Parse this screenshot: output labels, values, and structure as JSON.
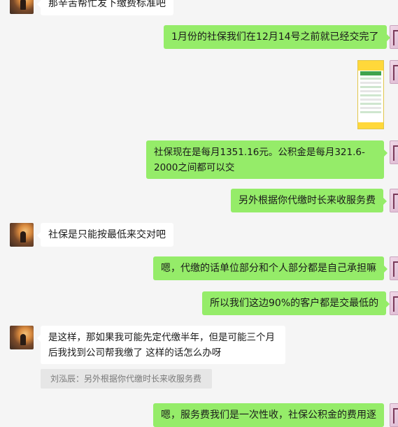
{
  "messages": [
    {
      "text": "那辛苦帮忙发下缴费标准吧"
    },
    {
      "text": "1月份的社保我们在12月14号之前就已经交完了"
    },
    {
      "text": "社保现在是每月1351.16元。公积金是每月321.6-2000之间都可以交"
    },
    {
      "text": "另外根据你代缴时长来收服务费"
    },
    {
      "text": "社保是只能按最低来交对吧"
    },
    {
      "text": "嗯，代缴的话单位部分和个人部分都是自己承担嘛"
    },
    {
      "text": "所以我们这边90%的客户都是交最低的"
    },
    {
      "text": "是这样，那如果我可能先定代缴半年，但是可能三个月后我找到公司帮我缴了  这样的话怎么办呀"
    },
    {
      "quote": "刘泓辰：另外根据你代缴时长来收服务费"
    },
    {
      "text": "嗯，服务费我们是一次性收，社保公积金的费用逐"
    }
  ],
  "colors": {
    "outgoing_bubble": "#95ec69",
    "incoming_bubble": "#ffffff",
    "background": "#f5f5f5",
    "quote_bg": "#e6e6e6"
  },
  "icons": {
    "image_message": "fee-standard-image-thumbnail"
  }
}
